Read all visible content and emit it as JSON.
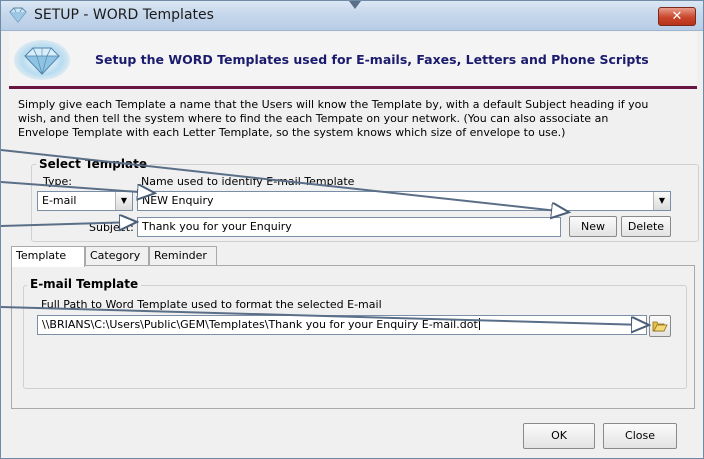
{
  "window": {
    "title": "SETUP - WORD Templates",
    "close_label": "✕"
  },
  "banner": {
    "text": "Setup the WORD Templates used for E-mails, Faxes, Letters and Phone Scripts",
    "icon": "diamond-icon"
  },
  "description": {
    "line1": "Simply give each Template a name that the Users will know the Template by, with a default Subject heading if you",
    "line2": "wish, and then tell the system where to find the each Tempate on your network.  (You can also associate an",
    "line3": "Envelope Template with each Letter Template, so the system knows which size of envelope to use.)"
  },
  "select_template": {
    "group_title": "Select Template",
    "type_label": "Type:",
    "type_value": "E-mail",
    "name_label": "Name used to identify E-mail Template",
    "name_value": "NEW Enquiry",
    "subject_label": "Subject:",
    "subject_value": "Thank you for your Enquiry",
    "new_label": "New",
    "delete_label": "Delete"
  },
  "tabs": [
    {
      "label": "Template",
      "active": true
    },
    {
      "label": "Category",
      "active": false
    },
    {
      "label": "Reminder",
      "active": false
    }
  ],
  "email_template": {
    "group_title": "E-mail Template",
    "path_label": "Full Path to Word Template used to format the selected E-mail",
    "path_value": "\\\\BRIANS\\C:\\Users\\Public\\GEM\\Templates\\Thank you for your Enquiry E-mail.dot",
    "browse_icon": "folder-open-icon"
  },
  "footer": {
    "ok_label": "OK",
    "close_label": "Close"
  },
  "colors": {
    "banner_text": "#1b1b6e",
    "banner_rule": "#6a1541",
    "arrow": "#5a6f87"
  }
}
